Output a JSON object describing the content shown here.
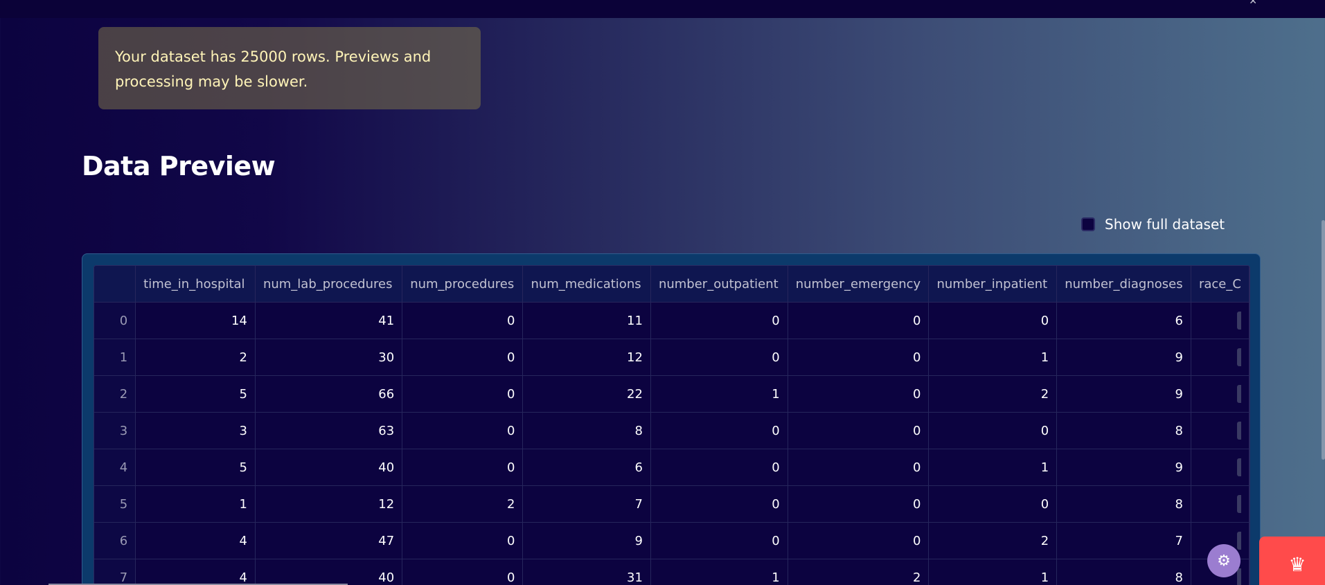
{
  "warning": {
    "text": "Your dataset has 25000 rows. Previews and processing may be slower."
  },
  "page": {
    "title": "Data Preview"
  },
  "show_full": {
    "label": "Show full dataset",
    "checked": false
  },
  "table": {
    "columns": [
      "",
      "time_in_hospital",
      "num_lab_procedures",
      "num_procedures",
      "num_medications",
      "number_outpatient",
      "number_emergency",
      "number_inpatient",
      "number_diagnoses",
      "race_C"
    ],
    "rows": [
      [
        "0",
        "14",
        "41",
        "0",
        "11",
        "0",
        "0",
        "0",
        "6"
      ],
      [
        "1",
        "2",
        "30",
        "0",
        "12",
        "0",
        "0",
        "1",
        "9"
      ],
      [
        "2",
        "5",
        "66",
        "0",
        "22",
        "1",
        "0",
        "2",
        "9"
      ],
      [
        "3",
        "3",
        "63",
        "0",
        "8",
        "0",
        "0",
        "0",
        "8"
      ],
      [
        "4",
        "5",
        "40",
        "0",
        "6",
        "0",
        "0",
        "1",
        "9"
      ],
      [
        "5",
        "1",
        "12",
        "2",
        "7",
        "0",
        "0",
        "0",
        "8"
      ],
      [
        "6",
        "4",
        "47",
        "0",
        "9",
        "0",
        "0",
        "2",
        "7"
      ],
      [
        "7",
        "4",
        "40",
        "0",
        "31",
        "1",
        "2",
        "1",
        "8"
      ]
    ]
  },
  "icons": {
    "topbar_close": "close-icon",
    "status": "running-status-icon",
    "badge": "streamlit-crown-icon"
  },
  "colors": {
    "warning_text": "#fff4b8",
    "badge_bg": "#ff4b4b",
    "table_frame": "#0c3a6b"
  }
}
